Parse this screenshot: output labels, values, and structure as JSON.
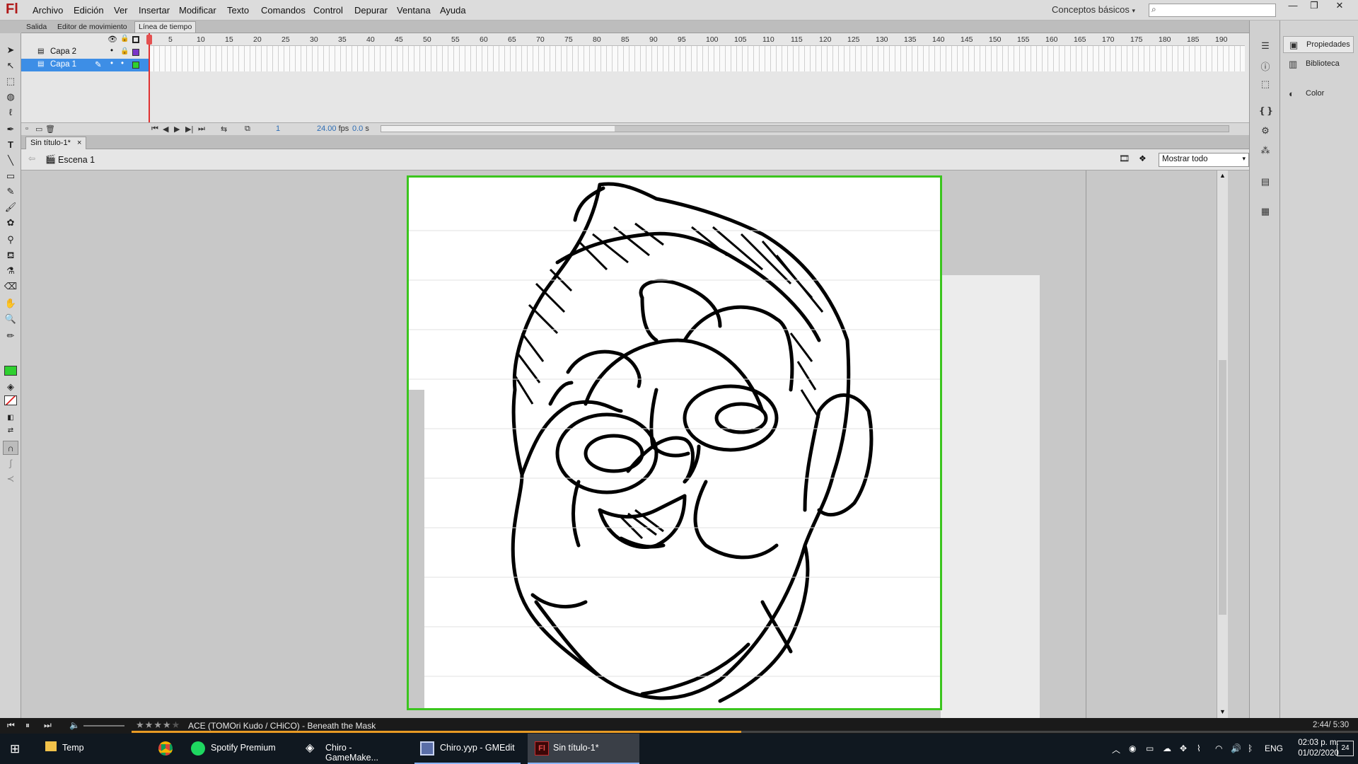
{
  "app": {
    "logo": "Fl"
  },
  "menu": [
    "Archivo",
    "Edición",
    "Ver",
    "Insertar",
    "Modificar",
    "Texto",
    "Comandos",
    "Control",
    "Depurar",
    "Ventana",
    "Ayuda"
  ],
  "workspace": "Conceptos básicos",
  "search": {
    "icon": "search-icon",
    "value": ""
  },
  "panel_tabs": [
    "Salida",
    "Editor de movimiento",
    "Línea de tiempo"
  ],
  "timeline": {
    "layers": [
      {
        "name": "Capa 2",
        "color": "#7a35c9"
      },
      {
        "name": "Capa 1",
        "color": "#2fd030"
      }
    ],
    "frame_numbers": [
      "5",
      "10",
      "15",
      "20",
      "25",
      "30",
      "35",
      "40",
      "45",
      "50",
      "55",
      "60",
      "65",
      "70",
      "75",
      "80",
      "85",
      "90",
      "95",
      "100",
      "105",
      "110",
      "115",
      "120",
      "125",
      "130",
      "135",
      "140",
      "145",
      "150",
      "155",
      "160",
      "165",
      "170",
      "175",
      "180",
      "185",
      "190"
    ],
    "current_frame": "1",
    "fps": "24.00",
    "fps_unit": "fps",
    "time": "0.0",
    "time_unit": "s"
  },
  "document": {
    "tab": "Sin título-1*",
    "close": "×",
    "scene": "Escena 1",
    "zoom": "Mostrar todo"
  },
  "right_panels": [
    "Propiedades",
    "Biblioteca",
    "Color"
  ],
  "media": {
    "rating": "★★★★★",
    "rating_value": 4,
    "track": "ACE (TOMOri Kudo / CHiCO) - Beneath the Mask",
    "time": "2:44/ 5:30",
    "progress": 0.497
  },
  "taskbar": {
    "items": [
      "Temp",
      "",
      "Spotify Premium",
      "Chiro - GameMake...",
      "Chiro.yyp - GMEdit",
      "Sin título-1*"
    ],
    "lang": "ENG",
    "clock_time": "02:03 p. m.",
    "clock_date": "01/02/2020",
    "notifications": "24"
  },
  "colors": {
    "accent": "#3bc51e",
    "selection": "#3d8ee6",
    "playhead": "#e03030"
  }
}
